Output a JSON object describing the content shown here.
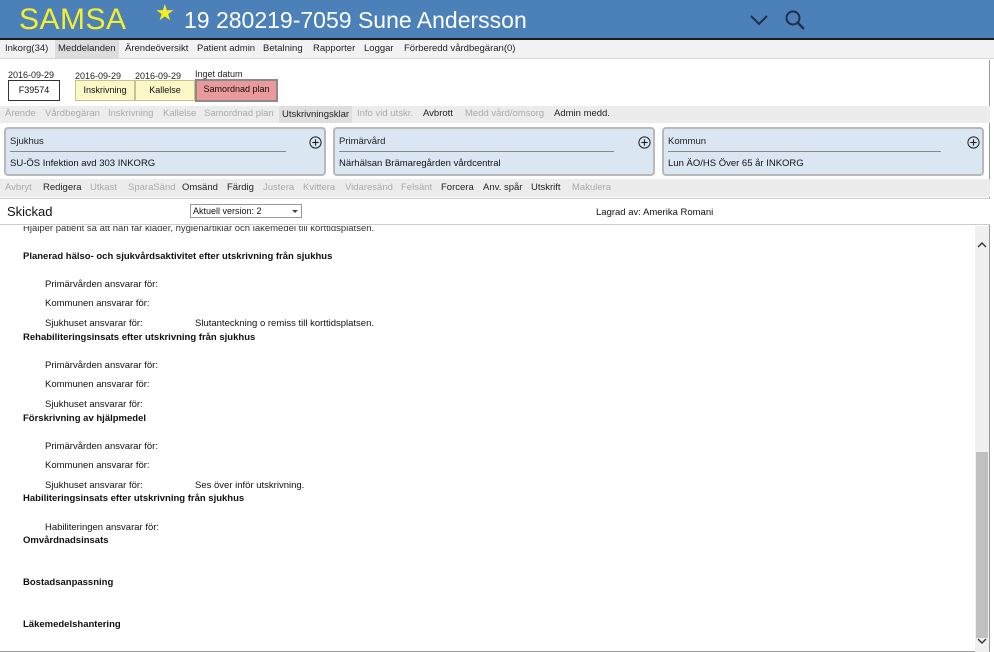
{
  "header": {
    "app_name": "SAMSA",
    "patient": "19 280219-7059 Sune Andersson",
    "icons": [
      "star-icon",
      "chevron-down-icon",
      "search-icon"
    ]
  },
  "menu": {
    "items": [
      "Inkorg(34)",
      "Meddelanden",
      "Ärendeöversikt",
      "Patient admin",
      "Betalning",
      "Rapporter",
      "Loggar",
      "Förberedd vårdbegäran(0)"
    ],
    "active": "Meddelanden"
  },
  "timeline": {
    "id_date": "2016-09-29",
    "id": "F39574",
    "steps": [
      {
        "date": "2016-09-29",
        "label": "Inskrivning"
      },
      {
        "date": "2016-09-29",
        "label": "Kallelse"
      },
      {
        "date": "Inget datum",
        "label": "Samordnad plan"
      }
    ]
  },
  "action_bar": {
    "items": [
      "Ärende",
      "Vårdbegäran",
      "Inskrivning",
      "Kallelse",
      "Samordnad plan",
      "Utskrivningsklar",
      "Info vid utskr.",
      "Avbrott",
      "Medd vård/omsorg",
      "Admin medd."
    ]
  },
  "panels": [
    {
      "title": "Sjukhus",
      "value": "SU-ÖS Infektion avd 303 INKORG"
    },
    {
      "title": "Primärvård",
      "value": "Närhälsan Brämaregården vårdcentral"
    },
    {
      "title": "Kommun",
      "value": "Lun ÄO/HS Över 65 år INKORG"
    }
  ],
  "doc_bar": {
    "items": [
      "Avbryt",
      "Redigera",
      "Utkast",
      "SparaSänd",
      "Omsänd",
      "Färdig",
      "Justera",
      "Kvittera",
      "Vidaresänd",
      "Felsänt",
      "Forcera",
      "Anv. spår",
      "Utskrift",
      "Makulera"
    ]
  },
  "status": {
    "state": "Skickad",
    "version": "Aktuell version: 2",
    "saved_by": "Lagrad av: Amerika Romani"
  },
  "content": {
    "top_text": "Hjälper patient så att han får kläder, hygienartiklar och läkemedel till korttidsplatsen.",
    "sections": [
      {
        "heading": "Planerad hälso- och sjukvårdsaktivitet efter utskrivning från sjukhus",
        "rows": [
          {
            "label": "Primärvården ansvarar för:",
            "value": ""
          },
          {
            "label": "Kommunen ansvarar för:",
            "value": ""
          },
          {
            "label": "Sjukhuset ansvarar för:",
            "value": "Slutanteckning o remiss till korttidsplatsen."
          }
        ]
      },
      {
        "heading": "Rehabiliteringsinsats efter utskrivning från sjukhus",
        "rows": [
          {
            "label": "Primärvården ansvarar för:",
            "value": ""
          },
          {
            "label": "Kommunen ansvarar för:",
            "value": ""
          },
          {
            "label": "Sjukhuset ansvarar för:",
            "value": ""
          }
        ]
      },
      {
        "heading": "Förskrivning av hjälpmedel",
        "rows": [
          {
            "label": "Primärvården ansvarar för:",
            "value": ""
          },
          {
            "label": "Kommunen ansvarar för:",
            "value": ""
          },
          {
            "label": "Sjukhuset ansvarar för:",
            "value": "Ses över inför utskrivning."
          }
        ]
      },
      {
        "heading": "Habiliteringsinsats efter utskrivning från sjukhus",
        "rows": [
          {
            "label": "Habiliteringen ansvarar för:",
            "value": ""
          }
        ]
      },
      {
        "heading": "Omvårdnadsinsats",
        "rows": []
      },
      {
        "heading": "Bostadsanpassning",
        "rows": []
      },
      {
        "heading": "Läkemedelshantering",
        "rows": []
      }
    ]
  }
}
